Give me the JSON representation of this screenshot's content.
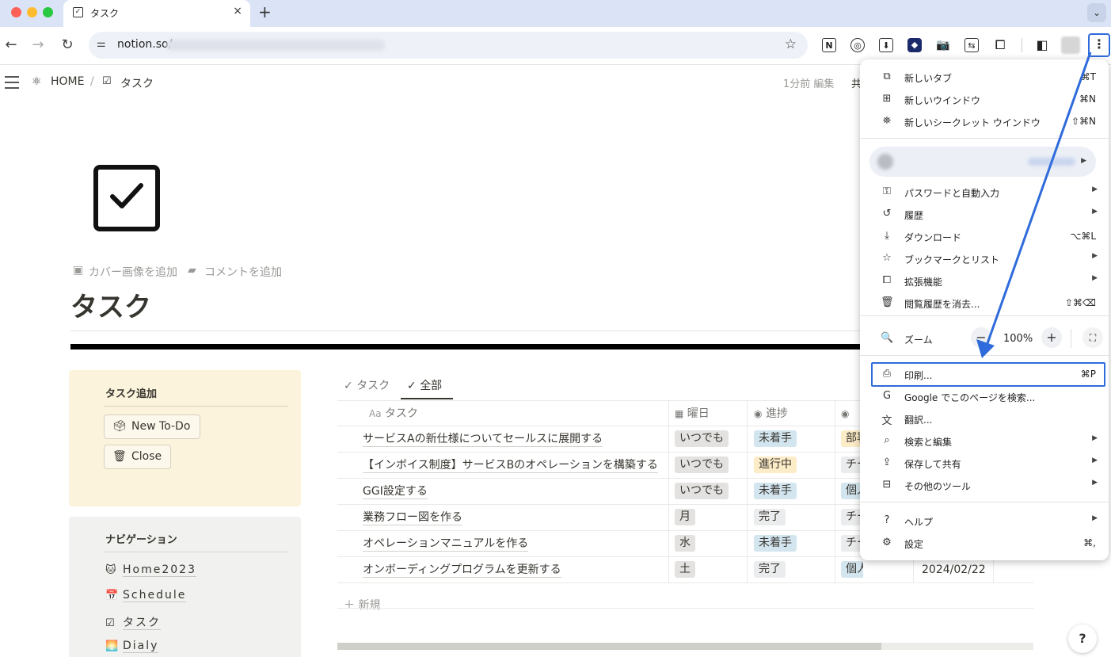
{
  "browser": {
    "tab_title": "タスク",
    "tab_close": "×",
    "new_tab": "+",
    "tabs_menu": "⌄",
    "url": "notion.so/",
    "back": "←",
    "forward": "→",
    "reload": "↻",
    "kebab": "⋮",
    "bookmark_star": "☆"
  },
  "extensions": [
    "notion-icon",
    "note-icon",
    "download-icon",
    "shield-icon",
    "camera-icon",
    "translate-icon",
    "puzzle-icon",
    "sidebar-icon"
  ],
  "notion": {
    "breadcrumb_home": "HOME",
    "breadcrumb_sep": "/",
    "breadcrumb_page": "タスク",
    "edited": "1分前 編集",
    "share": "共",
    "add_cover": "カバー画像を追加",
    "add_comment": "コメントを追加",
    "page_title": "タスク",
    "task_callout": {
      "heading": "タスク追加",
      "buttons": [
        {
          "emoji": "🗳",
          "label": "New To-Do"
        },
        {
          "emoji": "🗑",
          "label": "Close"
        }
      ]
    },
    "nav_callout": {
      "heading": "ナビゲーション",
      "links": [
        {
          "glyph": "🐱",
          "label": "Home2023"
        },
        {
          "glyph": "📅",
          "label": "Schedule"
        },
        {
          "glyph": "☑",
          "label": "タスク"
        },
        {
          "glyph": "🌅",
          "label": "Dialy"
        }
      ]
    },
    "views": [
      {
        "icon": "✓",
        "label": "タスク"
      },
      {
        "icon": "✓",
        "label": "全部"
      }
    ],
    "columns": [
      {
        "icon": "Aa",
        "label": "タスク"
      },
      {
        "icon": "▦",
        "label": "曜日"
      },
      {
        "icon": "◉",
        "label": "進捗"
      },
      {
        "icon": "◉",
        "label": ""
      }
    ],
    "rows": [
      {
        "task": "サービスAの新仕様についてセールスに展開する",
        "day": "いつでも",
        "status": "未着手",
        "owner": "部署",
        "date": ""
      },
      {
        "task": "【インボイス制度】サービスBのオペレーションを構築する",
        "day": "いつでも",
        "status": "進行中",
        "owner": "チー",
        "date": ""
      },
      {
        "task": "GGI設定する",
        "day": "いつでも",
        "status": "未着手",
        "owner": "個人",
        "date": ""
      },
      {
        "task": "業務フロー図を作る",
        "day": "月",
        "status": "完了",
        "owner": "チー",
        "date": ""
      },
      {
        "task": "オペレーションマニュアルを作る",
        "day": "水",
        "status": "未着手",
        "owner": "チー",
        "date": ""
      },
      {
        "task": "オンボーディングプログラムを更新する",
        "day": "土",
        "status": "完了",
        "owner": "個人",
        "date": "2024/02/22"
      }
    ],
    "new_row": "＋ 新規",
    "help": "?"
  },
  "menu": {
    "items_top": [
      {
        "icon": "new-tab-icon",
        "glyph": "⧉",
        "label": "新しいタブ",
        "shortcut": "⌘T"
      },
      {
        "icon": "new-window-icon",
        "glyph": "⊞",
        "label": "新しいウインドウ",
        "shortcut": "⌘N"
      },
      {
        "icon": "incognito-icon",
        "glyph": "⛯",
        "label": "新しいシークレット ウインドウ",
        "shortcut": "⇧⌘N"
      }
    ],
    "items_mid": [
      {
        "icon": "key-icon",
        "glyph": "⚿",
        "label": "パスワードと自動入力",
        "shortcut": "",
        "submenu": true
      },
      {
        "icon": "history-icon",
        "glyph": "↺",
        "label": "履歴",
        "shortcut": "",
        "submenu": true
      },
      {
        "icon": "download-icon",
        "glyph": "⤓",
        "label": "ダウンロード",
        "shortcut": "⌥⌘L",
        "submenu": false
      },
      {
        "icon": "bookmark-star-icon",
        "glyph": "☆",
        "label": "ブックマークとリスト",
        "shortcut": "",
        "submenu": true
      },
      {
        "icon": "extensions-icon",
        "glyph": "⧠",
        "label": "拡張機能",
        "shortcut": "",
        "submenu": true
      },
      {
        "icon": "trash-icon",
        "glyph": "🗑",
        "label": "閲覧履歴を消去...",
        "shortcut": "⇧⌘⌫",
        "submenu": false
      }
    ],
    "zoom": {
      "label": "ズーム",
      "minus": "−",
      "plus": "+",
      "value": "100%",
      "fullscreen": "⛶"
    },
    "items_tools": [
      {
        "icon": "print-icon",
        "glyph": "⎙",
        "label": "印刷...",
        "shortcut": "⌘P",
        "submenu": false
      },
      {
        "icon": "google-icon",
        "glyph": "G",
        "label": "Google でこのページを検索...",
        "shortcut": "",
        "submenu": false
      },
      {
        "icon": "translate-icon",
        "glyph": "文",
        "label": "翻訳...",
        "shortcut": "",
        "submenu": false
      },
      {
        "icon": "search-edit-icon",
        "glyph": "⌕",
        "label": "検索と編集",
        "shortcut": "",
        "submenu": true
      },
      {
        "icon": "save-share-icon",
        "glyph": "⇪",
        "label": "保存して共有",
        "shortcut": "",
        "submenu": true
      },
      {
        "icon": "toolbox-icon",
        "glyph": "⊟",
        "label": "その他のツール",
        "shortcut": "",
        "submenu": true
      }
    ],
    "items_bottom": [
      {
        "icon": "help-icon",
        "glyph": "?",
        "label": "ヘルプ",
        "shortcut": "",
        "submenu": true
      },
      {
        "icon": "settings-gear-icon",
        "glyph": "⚙",
        "label": "設定",
        "shortcut": "⌘,",
        "submenu": false
      }
    ]
  },
  "colors": {
    "accent": "#2f6bdb",
    "callout_yellow": "#fbf3db",
    "callout_gray": "#f1f1ef"
  }
}
